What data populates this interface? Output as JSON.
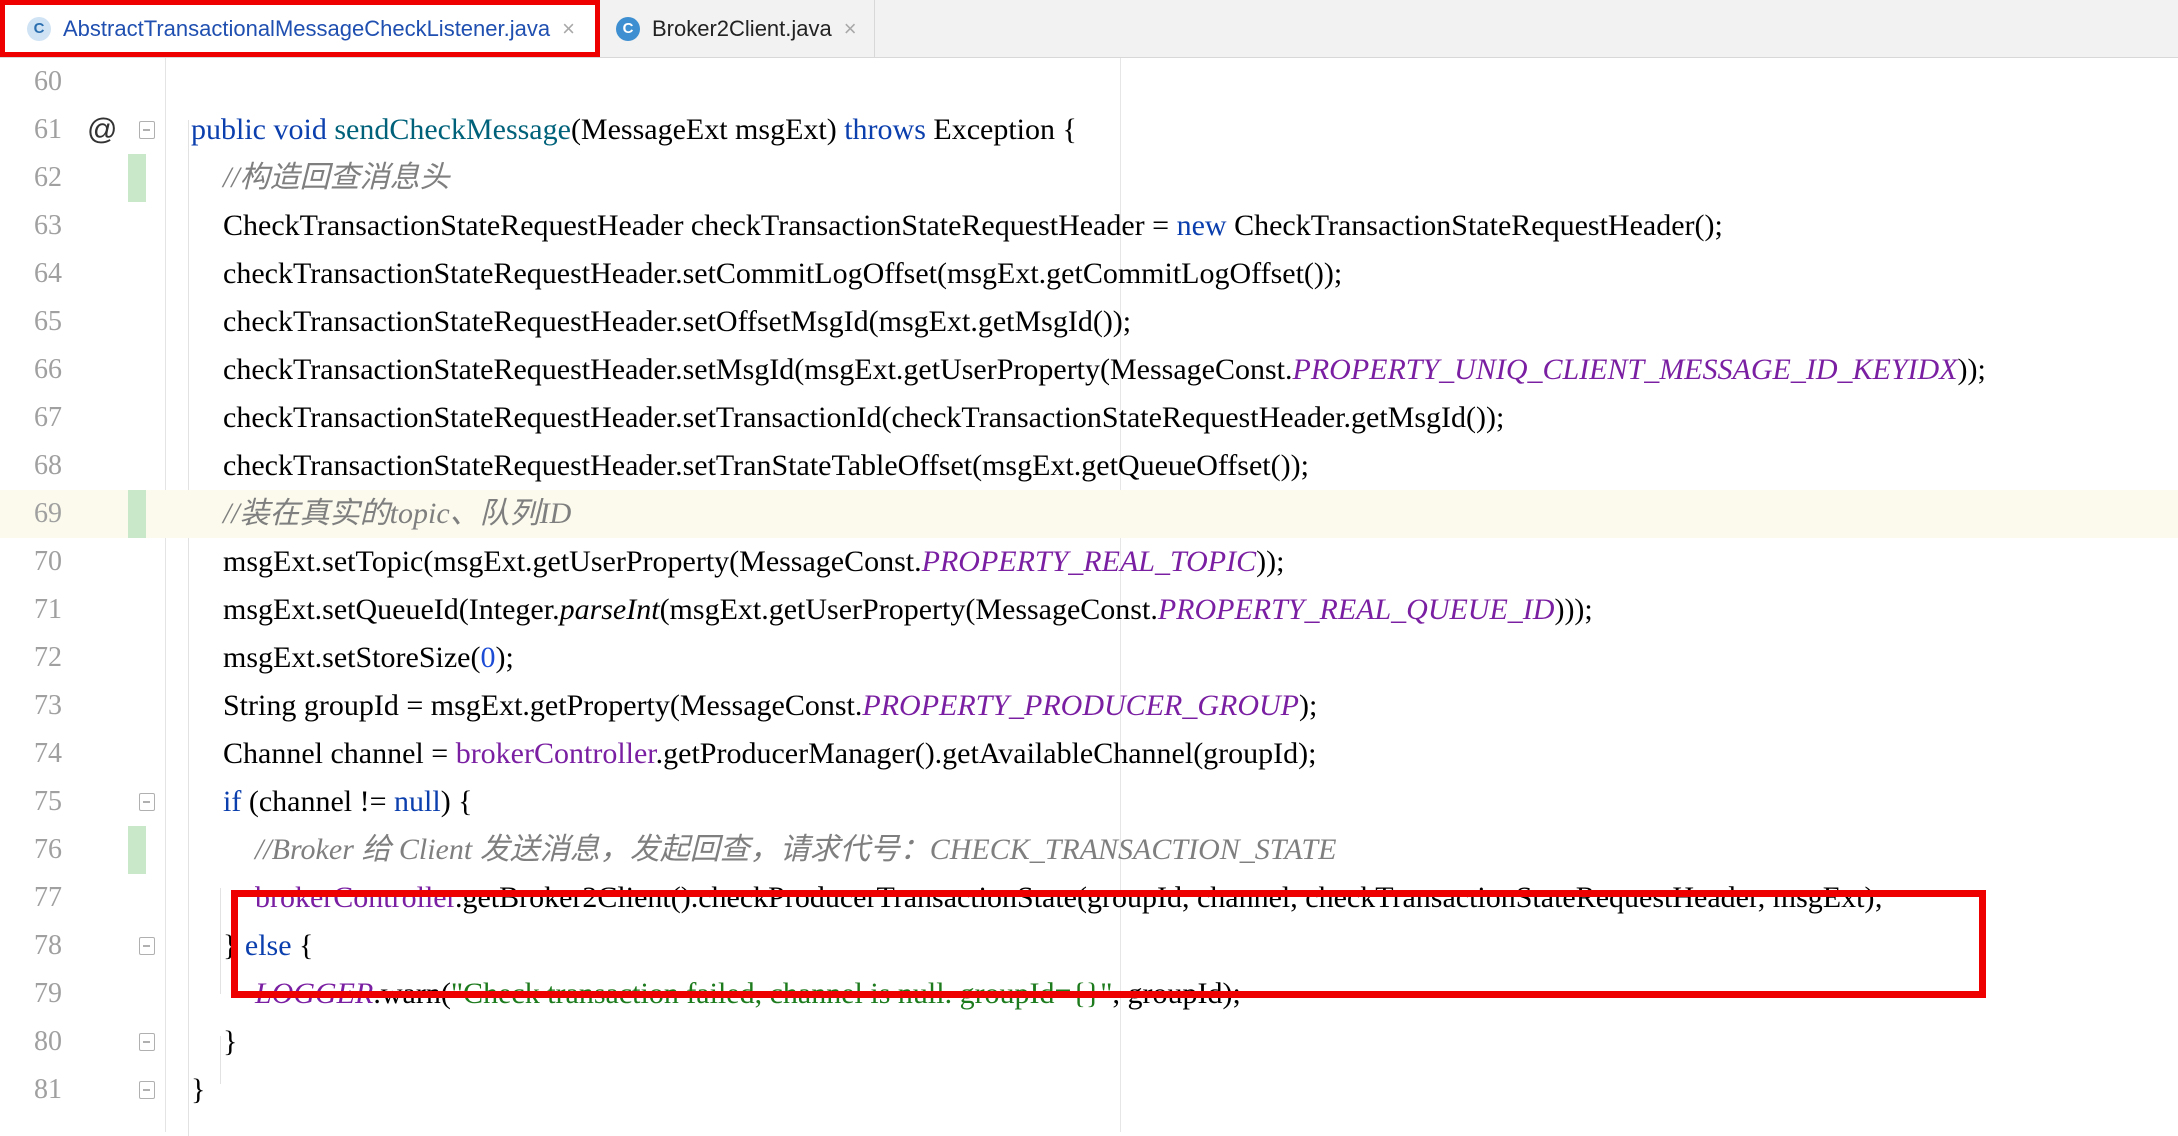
{
  "tabs": [
    {
      "icon": "class-c-icon",
      "label": "AbstractTransactionalMessageCheckListener.java",
      "active": true,
      "close": "×"
    },
    {
      "icon": "class-c-icon",
      "label": "Broker2Client.java",
      "active": false,
      "close": "×"
    }
  ],
  "line_numbers": [
    "60",
    "61",
    "62",
    "63",
    "64",
    "65",
    "66",
    "67",
    "68",
    "69",
    "70",
    "71",
    "72",
    "73",
    "74",
    "75",
    "76",
    "77",
    "78",
    "79",
    "80",
    "81"
  ],
  "override_marker": "@",
  "code": {
    "l61": {
      "a": "public void ",
      "b": "sendCheckMessage",
      "c": "(MessageExt msgExt) ",
      "d": "throws",
      " e": "",
      "e2": " Exception {"
    },
    "l62": "//构造回查消息头",
    "l63": {
      "a": "CheckTransactionStateRequestHeader checkTransactionStateRequestHeader = ",
      "b": "new",
      "c": " CheckTransactionStateRequestHeader();"
    },
    "l64": "checkTransactionStateRequestHeader.setCommitLogOffset(msgExt.getCommitLogOffset());",
    "l65": "checkTransactionStateRequestHeader.setOffsetMsgId(msgExt.getMsgId());",
    "l66": {
      "a": "checkTransactionStateRequestHeader.setMsgId(msgExt.getUserProperty(MessageConst.",
      "b": "PROPERTY_UNIQ_CLIENT_MESSAGE_ID_KEYIDX",
      "c": "));"
    },
    "l67": "checkTransactionStateRequestHeader.setTransactionId(checkTransactionStateRequestHeader.getMsgId());",
    "l68": "checkTransactionStateRequestHeader.setTranStateTableOffset(msgExt.getQueueOffset());",
    "l69": "//装在真实的topic、队列ID",
    "l70": {
      "a": "msgExt.setTopic(msgExt.getUserProperty(MessageConst.",
      "b": "PROPERTY_REAL_TOPIC",
      "c": "));"
    },
    "l71": {
      "a": "msgExt.setQueueId(Integer.",
      "b": "parseInt",
      "c": "(msgExt.getUserProperty(MessageConst.",
      "d": "PROPERTY_REAL_QUEUE_ID",
      "e": ")));"
    },
    "l72": {
      "a": "msgExt.setStoreSize(",
      "b": "0",
      "c": ");"
    },
    "l73": {
      "a": "String groupId = msgExt.getProperty(MessageConst.",
      "b": "PROPERTY_PRODUCER_GROUP",
      "c": ");"
    },
    "l74": {
      "a": "Channel channel = ",
      "b": "brokerController",
      "c": ".getProducerManager().getAvailableChannel(groupId);"
    },
    "l75": {
      "a": "if",
      "b": " (channel != ",
      "c": "null",
      "d": ") {"
    },
    "l76": "//Broker 给 Client 发送消息，发起回查，请求代号：CHECK_TRANSACTION_STATE",
    "l77": {
      "a": "brokerController",
      "b": ".getBroker2Client().checkProducerTransactionState(groupId, channel, checkTransactionStateRequestHeader, msgExt);"
    },
    "l78": {
      "a": "} ",
      "b": "else",
      "c": " {"
    },
    "l79": {
      "a": "LOGGER",
      "b": ".warn(",
      "c": "\"Check transaction failed, channel is null. groupId={}\"",
      "d": ", groupId);"
    },
    "l80": "}",
    "l81": "}"
  }
}
